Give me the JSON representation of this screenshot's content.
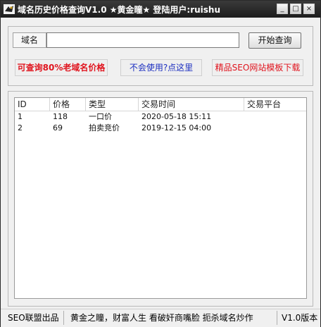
{
  "window": {
    "title": "域名历史价格查询V1.0 ★黄金瞳★  登陆用户:ruishu",
    "minimize_label": "_",
    "maximize_label": "□",
    "close_label": "×"
  },
  "search": {
    "label": "域名",
    "value": "",
    "placeholder": "",
    "button_label": "开始查询"
  },
  "promos": {
    "left": "可查询80%老域名价格",
    "middle": "不会使用?点这里",
    "right": "精品SEO网站模板下载"
  },
  "table": {
    "columns": [
      "ID",
      "价格",
      "类型",
      "交易时间",
      "交易平台"
    ],
    "rows": [
      {
        "id": "1",
        "price": "118",
        "type": "一口价",
        "time": "2020-05-18 15:11",
        "platform": ""
      },
      {
        "id": "2",
        "price": "69",
        "type": "拍卖竞价",
        "time": "2019-12-15 04:00",
        "platform": ""
      }
    ]
  },
  "status": {
    "left": "SEO联盟出品",
    "middle": "黄金之瞳，财富人生 看破奸商嘴脸 扼杀域名炒作",
    "right": "V1.0版本"
  },
  "colors": {
    "title_bg": "#1d1d1d",
    "promo_red": "#e0141e",
    "promo_blue": "#1c2fc0"
  }
}
